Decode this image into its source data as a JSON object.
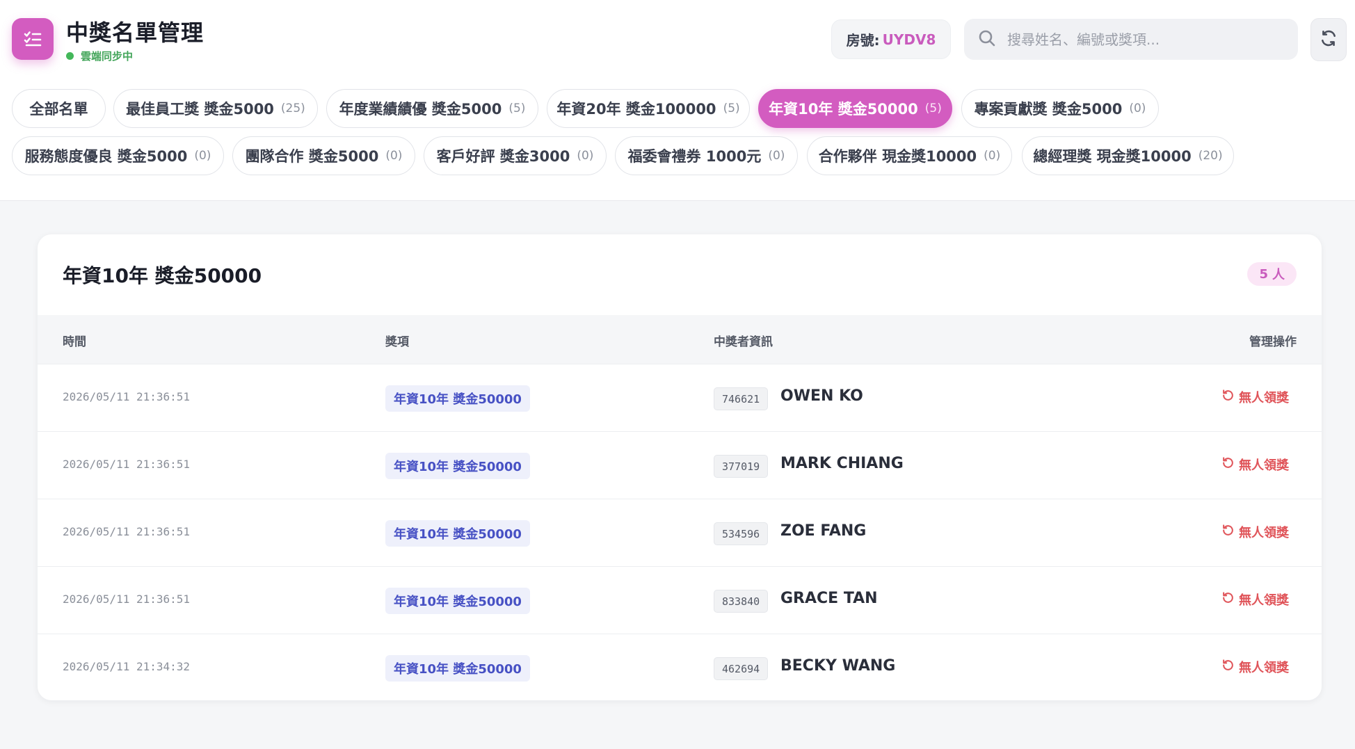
{
  "app": {
    "title": "中獎名單管理",
    "sync_status": "雲端同步中",
    "room_label": "房號:",
    "room_code": "UYDV8"
  },
  "search": {
    "placeholder": "搜尋姓名、編號或獎項..."
  },
  "colors": {
    "accent": "#d35cc0",
    "sync": "#43b75a",
    "danger": "#e0555a",
    "prize": "#4751c4"
  },
  "icons": {
    "app": "checklist-icon",
    "search": "search-icon",
    "refresh": "refresh-icon",
    "undo": "undo-icon"
  },
  "tabs": [
    {
      "label": "全部名單",
      "count": ""
    },
    {
      "label": "最佳員工獎 獎金5000",
      "count": "(25)"
    },
    {
      "label": "年度業績績優 獎金5000",
      "count": "(5)"
    },
    {
      "label": "年資20年 獎金100000",
      "count": "(5)"
    },
    {
      "label": "年資10年 獎金50000",
      "count": "(5)",
      "active": true
    },
    {
      "label": "專案貢獻獎 獎金5000",
      "count": "(0)"
    },
    {
      "label": "服務態度優良 獎金5000",
      "count": "(0)"
    },
    {
      "label": "團隊合作 獎金5000",
      "count": "(0)"
    },
    {
      "label": "客戶好評 獎金3000",
      "count": "(0)"
    },
    {
      "label": "福委會禮券 1000元",
      "count": "(0)"
    },
    {
      "label": "合作夥伴 現金獎10000",
      "count": "(0)"
    },
    {
      "label": "總經理獎 現金獎10000",
      "count": "(20)"
    }
  ],
  "panel": {
    "title": "年資10年 獎金50000",
    "count_number": "5",
    "count_unit": "人",
    "columns": [
      "時間",
      "獎項",
      "中獎者資訊",
      "管理操作"
    ],
    "rows": [
      {
        "time": "2026/05/11 21:36:51",
        "prize": "年資10年 獎金50000",
        "id": "746621",
        "name": "OWEN KO",
        "action": "無人領獎"
      },
      {
        "time": "2026/05/11 21:36:51",
        "prize": "年資10年 獎金50000",
        "id": "377019",
        "name": "MARK CHIANG",
        "action": "無人領獎"
      },
      {
        "time": "2026/05/11 21:36:51",
        "prize": "年資10年 獎金50000",
        "id": "534596",
        "name": "ZOE FANG",
        "action": "無人領獎"
      },
      {
        "time": "2026/05/11 21:36:51",
        "prize": "年資10年 獎金50000",
        "id": "833840",
        "name": "GRACE TAN",
        "action": "無人領獎"
      },
      {
        "time": "2026/05/11 21:34:32",
        "prize": "年資10年 獎金50000",
        "id": "462694",
        "name": "BECKY WANG",
        "action": "無人領獎"
      }
    ]
  }
}
